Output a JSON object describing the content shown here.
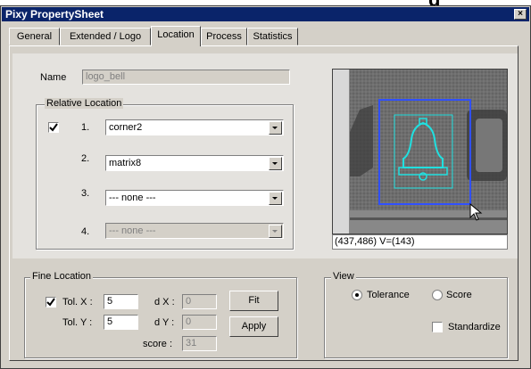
{
  "header_fragment": "g",
  "window": {
    "title": "Pixy PropertySheet",
    "close_glyph": "×"
  },
  "tabs": [
    {
      "label": "General",
      "active": false
    },
    {
      "label": "Extended / Logo",
      "active": false
    },
    {
      "label": "Location",
      "active": true
    },
    {
      "label": "Process",
      "active": false
    },
    {
      "label": "Statistics",
      "active": false
    }
  ],
  "name_field": {
    "label": "Name",
    "value": "logo_bell"
  },
  "relative_location": {
    "legend": "Relative Location",
    "rows": [
      {
        "number": "1.",
        "value": "corner2",
        "checked": true,
        "enabled": true
      },
      {
        "number": "2.",
        "value": "matrix8",
        "enabled": true
      },
      {
        "number": "3.",
        "value": "--- none ---",
        "enabled": true
      },
      {
        "number": "4.",
        "value": "--- none ---",
        "enabled": false
      }
    ]
  },
  "preview": {
    "coords_text": "(437,486) V=(143)"
  },
  "fine_location": {
    "legend": "Fine Location",
    "tol_x_label": "Tol. X :",
    "tol_x_value": "5",
    "tol_x_checked": true,
    "tol_y_label": "Tol. Y :",
    "tol_y_value": "5",
    "dx_label": "d X :",
    "dx_value": "0",
    "dy_label": "d Y :",
    "dy_value": "0",
    "score_label": "score :",
    "score_value": "31",
    "fit_button": "Fit",
    "apply_button": "Apply"
  },
  "view": {
    "legend": "View",
    "tolerance_label": "Tolerance",
    "tolerance_selected": true,
    "score_label": "Score",
    "standardize_label": "Standardize",
    "standardize_checked": false
  },
  "colors": {
    "titlebar": "#0a246a",
    "outer_box": "#3050ff",
    "inner_box": "#20e0e0",
    "dialog": "#d4d0c8"
  }
}
